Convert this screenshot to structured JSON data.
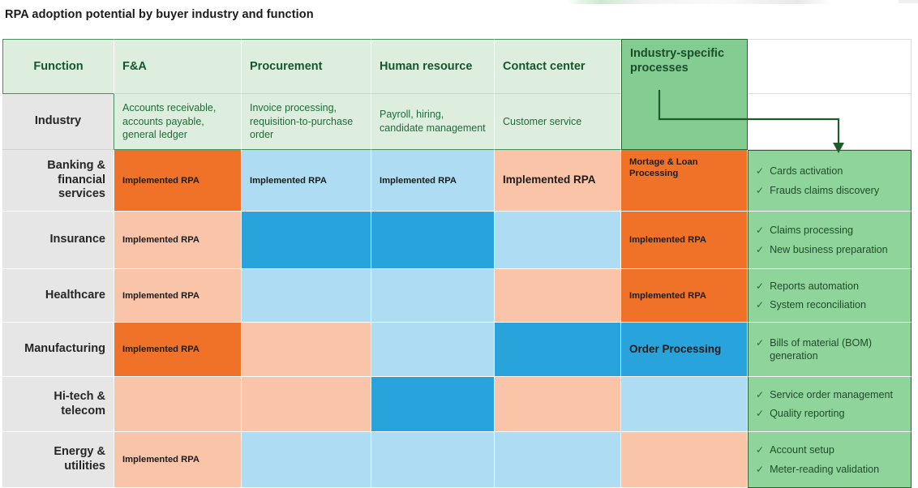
{
  "page_title": "RPA adoption potential by buyer industry and function",
  "header": {
    "function_label": "Function",
    "industry_label": "Industry",
    "columns": [
      {
        "name": "F&A",
        "examples": "Accounts receivable, accounts payable, general ledger"
      },
      {
        "name": "Procurement",
        "examples": "Invoice processing, requisition-to-purchase order"
      },
      {
        "name": "Human resource",
        "examples": "Payroll, hiring, candidate management"
      },
      {
        "name": "Contact center",
        "examples": "Customer service"
      },
      {
        "name": "Industry-specific processes",
        "examples": ""
      }
    ]
  },
  "legend_colors": {
    "orange_dark": "#ef7228",
    "orange_light": "#fac4a8",
    "blue_light": "#aedcf2",
    "blue_mid": "#29a3dc",
    "green_outcome": "#8fd49a",
    "header_green": "#ddeede",
    "isp_green": "#83cd93",
    "row_label_gray": "#e6e6e6",
    "border_green": "#27642f"
  },
  "icons": {
    "check": "✓",
    "arrow_head": "arrow-down-icon"
  },
  "rows": [
    {
      "industry": "Banking & financial services",
      "cells": [
        {
          "color": "orange_dark",
          "text": "Implemented RPA",
          "size": "small"
        },
        {
          "color": "blue_light",
          "text": "Implemented RPA",
          "size": "small"
        },
        {
          "color": "blue_light",
          "text": "Implemented RPA",
          "size": "small"
        },
        {
          "color": "orange_light",
          "text": "Implemented RPA",
          "size": "big"
        },
        {
          "color": "orange_dark",
          "text": "Mortage & Loan Processing",
          "size": "small",
          "align": "top"
        }
      ],
      "outcomes": [
        "Cards activation",
        "Frauds claims discovery"
      ]
    },
    {
      "industry": "Insurance",
      "cells": [
        {
          "color": "orange_light",
          "text": "Implemented RPA",
          "size": "small"
        },
        {
          "color": "blue_mid",
          "text": "",
          "size": "small"
        },
        {
          "color": "blue_mid",
          "text": "",
          "size": "small"
        },
        {
          "color": "blue_light",
          "text": "",
          "size": "small"
        },
        {
          "color": "orange_dark",
          "text": "Implemented RPA",
          "size": "small"
        }
      ],
      "outcomes": [
        "Claims processing",
        "New business preparation"
      ]
    },
    {
      "industry": "Healthcare",
      "cells": [
        {
          "color": "orange_light",
          "text": "Implemented RPA",
          "size": "small"
        },
        {
          "color": "blue_light",
          "text": "",
          "size": "small"
        },
        {
          "color": "blue_light",
          "text": "",
          "size": "small"
        },
        {
          "color": "orange_light",
          "text": "",
          "size": "small"
        },
        {
          "color": "orange_dark",
          "text": "Implemented RPA",
          "size": "small"
        }
      ],
      "outcomes": [
        "Reports automation",
        "System reconciliation"
      ]
    },
    {
      "industry": "Manufacturing",
      "cells": [
        {
          "color": "orange_dark",
          "text": "Implemented RPA",
          "size": "small"
        },
        {
          "color": "orange_light",
          "text": "",
          "size": "small"
        },
        {
          "color": "blue_light",
          "text": "",
          "size": "small"
        },
        {
          "color": "blue_mid",
          "text": "",
          "size": "small"
        },
        {
          "color": "blue_mid",
          "text": "Order Processing",
          "size": "big"
        }
      ],
      "outcomes": [
        "Bills of material (BOM) generation"
      ]
    },
    {
      "industry": "Hi-tech & telecom",
      "cells": [
        {
          "color": "orange_light",
          "text": "",
          "size": "small"
        },
        {
          "color": "orange_light",
          "text": "",
          "size": "small"
        },
        {
          "color": "blue_mid",
          "text": "",
          "size": "small"
        },
        {
          "color": "orange_light",
          "text": "",
          "size": "small"
        },
        {
          "color": "blue_light",
          "text": "",
          "size": "small"
        }
      ],
      "outcomes": [
        "Service order management",
        "Quality reporting"
      ]
    },
    {
      "industry": "Energy & utilities",
      "cells": [
        {
          "color": "orange_light",
          "text": "Implemented RPA",
          "size": "small"
        },
        {
          "color": "blue_light",
          "text": "",
          "size": "small"
        },
        {
          "color": "blue_light",
          "text": "",
          "size": "small"
        },
        {
          "color": "blue_light",
          "text": "",
          "size": "small"
        },
        {
          "color": "orange_light",
          "text": "",
          "size": "small"
        }
      ],
      "outcomes": [
        "Account setup",
        "Meter-reading validation"
      ]
    }
  ]
}
